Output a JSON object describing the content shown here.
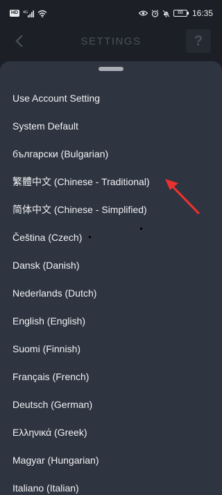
{
  "status_bar": {
    "network_badge": "HD",
    "battery_level": "66",
    "time": "16:35"
  },
  "app_bar": {
    "title": "SETTINGS",
    "help_label": "?"
  },
  "sheet": {
    "languages": [
      "Use Account Setting",
      "System Default",
      "български (Bulgarian)",
      "繁體中文 (Chinese - Traditional)",
      "简体中文 (Chinese - Simplified)",
      "Čeština (Czech)",
      "Dansk (Danish)",
      "Nederlands (Dutch)",
      "English (English)",
      "Suomi (Finnish)",
      "Français (French)",
      "Deutsch (German)",
      "Ελληνικά (Greek)",
      "Magyar (Hungarian)",
      "Italiano (Italian)"
    ]
  },
  "colors": {
    "background": "#1c2026",
    "sheet": "#2e3440",
    "text": "#f1f2f4",
    "annotation": "#e8322f"
  },
  "icons": {
    "back": "chevron-left-icon",
    "help": "question-mark-icon",
    "annotation": "red-arrow-icon"
  }
}
